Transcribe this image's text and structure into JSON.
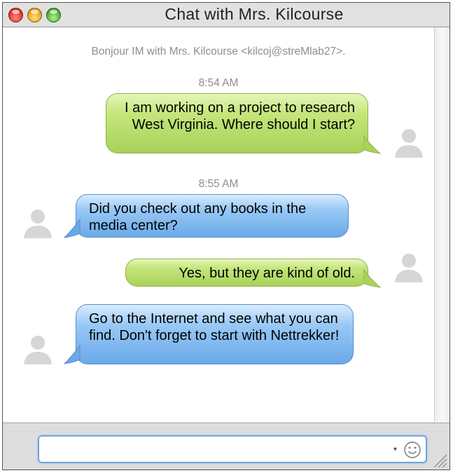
{
  "window": {
    "title": "Chat with Mrs. Kilcourse"
  },
  "chat": {
    "header": "Bonjour IM with Mrs. Kilcourse <kilcoj@streMlab27>.",
    "timestamps": [
      "8:54 AM",
      "8:55 AM"
    ],
    "messages": [
      {
        "sender": "me",
        "text": "I am working on a project to research West Virginia. Where should I start?",
        "color": "#b5dc6a"
      },
      {
        "sender": "them",
        "text": "Did you check out any books in the media center?",
        "color": "#8cc0f2"
      },
      {
        "sender": "me",
        "text": "Yes, but they are kind of old.",
        "color": "#b5dc6a"
      },
      {
        "sender": "them",
        "text": "Go to the Internet and see what you can find. Don't forget to start with Nettrekker!",
        "color": "#8cc0f2"
      }
    ]
  },
  "input": {
    "value": "",
    "emoji_icon": "smiley-icon"
  },
  "icons": {
    "close": "close-light-icon",
    "minimize": "minimize-light-icon",
    "zoom": "zoom-light-icon",
    "avatar": "user-silhouette-icon",
    "resize": "resize-grip-icon"
  }
}
